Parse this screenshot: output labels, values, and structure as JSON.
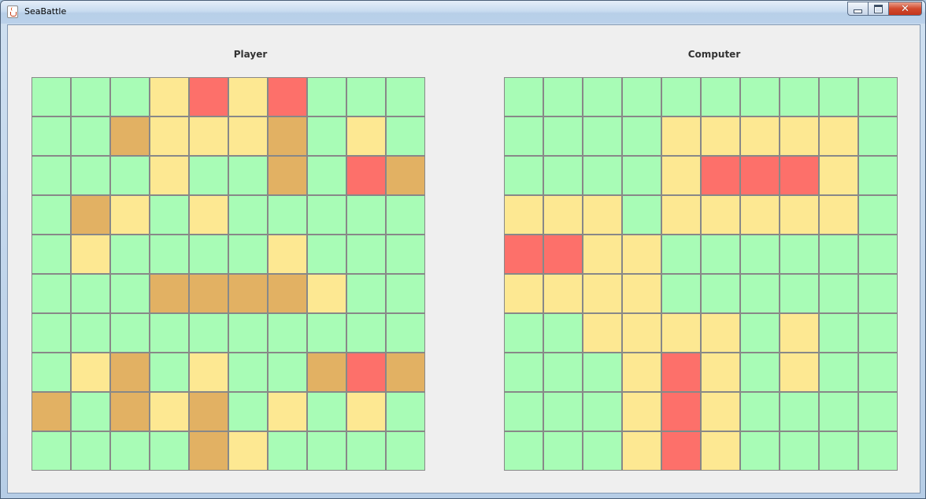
{
  "window": {
    "title": "SeaBattle",
    "controls": [
      "minimize",
      "maximize",
      "close"
    ],
    "close_glyph": "✕"
  },
  "legend": {
    "W": "water",
    "M": "miss",
    "H": "hit",
    "S": "ship"
  },
  "colors": {
    "W": "#a8fcb6",
    "M": "#fde892",
    "H": "#fd706a",
    "S": "#e2b163",
    "grid_line": "#888888",
    "panel_bg": "#efefef"
  },
  "boards": {
    "player": {
      "title": "Player",
      "cells": [
        [
          "W",
          "W",
          "W",
          "M",
          "H",
          "M",
          "H",
          "W",
          "W",
          "W"
        ],
        [
          "W",
          "W",
          "S",
          "M",
          "M",
          "M",
          "S",
          "W",
          "M",
          "W"
        ],
        [
          "W",
          "W",
          "W",
          "M",
          "W",
          "W",
          "S",
          "W",
          "H",
          "S"
        ],
        [
          "W",
          "S",
          "M",
          "W",
          "M",
          "W",
          "W",
          "W",
          "W",
          "W"
        ],
        [
          "W",
          "M",
          "W",
          "W",
          "W",
          "W",
          "M",
          "W",
          "W",
          "W"
        ],
        [
          "W",
          "W",
          "W",
          "S",
          "S",
          "S",
          "S",
          "M",
          "W",
          "W"
        ],
        [
          "W",
          "W",
          "W",
          "W",
          "W",
          "W",
          "W",
          "W",
          "W",
          "W"
        ],
        [
          "W",
          "M",
          "S",
          "W",
          "M",
          "W",
          "W",
          "S",
          "H",
          "S"
        ],
        [
          "S",
          "W",
          "S",
          "M",
          "S",
          "W",
          "M",
          "W",
          "M",
          "W"
        ],
        [
          "W",
          "W",
          "W",
          "W",
          "S",
          "M",
          "W",
          "W",
          "W",
          "W"
        ]
      ]
    },
    "computer": {
      "title": "Computer",
      "cells": [
        [
          "W",
          "W",
          "W",
          "W",
          "W",
          "W",
          "W",
          "W",
          "W",
          "W"
        ],
        [
          "W",
          "W",
          "W",
          "W",
          "M",
          "M",
          "M",
          "M",
          "M",
          "W"
        ],
        [
          "W",
          "W",
          "W",
          "W",
          "M",
          "H",
          "H",
          "H",
          "M",
          "W"
        ],
        [
          "M",
          "M",
          "M",
          "W",
          "M",
          "M",
          "M",
          "M",
          "M",
          "W"
        ],
        [
          "H",
          "H",
          "M",
          "M",
          "W",
          "W",
          "W",
          "W",
          "W",
          "W"
        ],
        [
          "M",
          "M",
          "M",
          "M",
          "W",
          "W",
          "W",
          "W",
          "W",
          "W"
        ],
        [
          "W",
          "W",
          "M",
          "M",
          "M",
          "M",
          "W",
          "M",
          "W",
          "W"
        ],
        [
          "W",
          "W",
          "W",
          "M",
          "H",
          "M",
          "W",
          "M",
          "W",
          "W"
        ],
        [
          "W",
          "W",
          "W",
          "M",
          "H",
          "M",
          "W",
          "W",
          "W",
          "W"
        ],
        [
          "W",
          "W",
          "W",
          "M",
          "H",
          "M",
          "W",
          "W",
          "W",
          "W"
        ]
      ]
    }
  }
}
